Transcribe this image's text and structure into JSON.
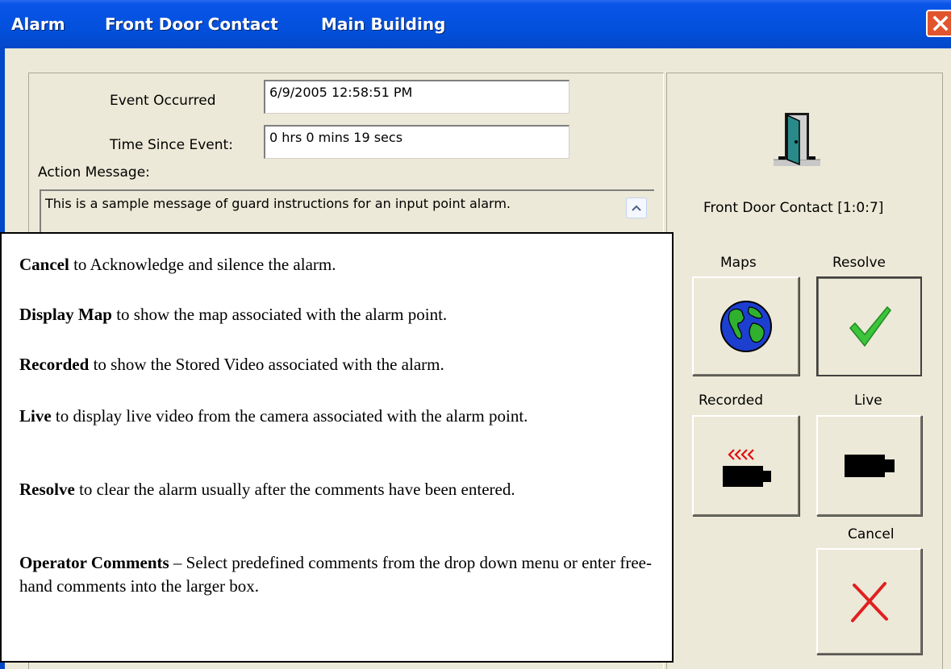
{
  "window": {
    "title_parts": [
      "Alarm",
      "Front Door Contact",
      "Main Building"
    ],
    "close_icon": "close-x-icon"
  },
  "event": {
    "occurred_label": "Event Occurred",
    "occurred_value": "6/9/2005 12:58:51 PM",
    "since_label": "Time Since Event:",
    "since_value": "0 hrs  0 mins  19 secs",
    "action_label": "Action Message:",
    "action_message": "This is a sample message of guard instructions for an input point alarm."
  },
  "point": {
    "icon": "open-door-icon",
    "name": "Front Door Contact  [1:0:7]"
  },
  "buttons": {
    "maps_label": "Maps",
    "resolve_label": "Resolve",
    "recorded_label": "Recorded",
    "live_label": "Live",
    "cancel_label": "Cancel"
  },
  "help": {
    "items": [
      {
        "term": "Cancel",
        "text": " to Acknowledge and silence the alarm."
      },
      {
        "term": "Display Map",
        "text": " to show the map associated with the alarm point."
      },
      {
        "term": "Recorded",
        "text": " to show the Stored Video associated with the alarm."
      },
      {
        "term": "Live",
        "text": " to display live video from the camera associated with the alarm point."
      },
      {
        "term": "Resolve",
        "text": " to clear the alarm usually after the comments have been entered."
      },
      {
        "term": "Operator Comments",
        "text": " – Select predefined comments from the drop down menu or enter free-hand comments into the larger box."
      }
    ]
  },
  "colors": {
    "titlebar": "#0250DC",
    "dialog_bg": "#ECE9D8",
    "check_green": "#3CC43C",
    "cancel_red": "#E02020",
    "rewind_red": "#E01010"
  }
}
